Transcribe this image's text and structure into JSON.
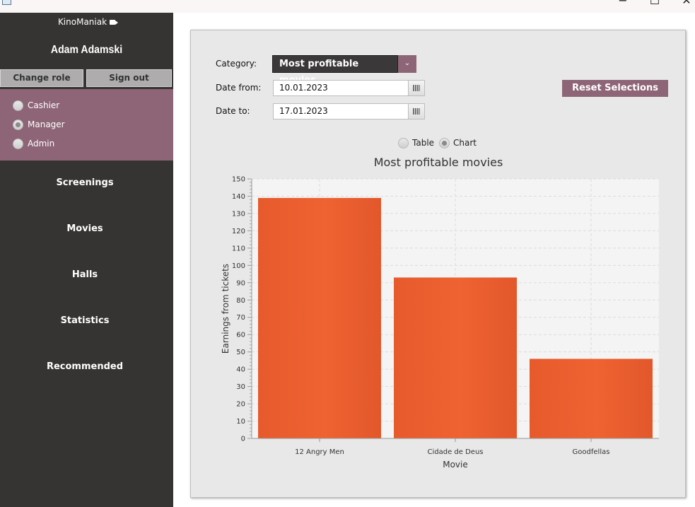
{
  "window": {
    "min_glyph": "−",
    "max_glyph": "☐",
    "close_glyph": "✕"
  },
  "sidebar": {
    "brand": "KinoManiak",
    "user_name": "Adam Adamski",
    "change_role_label": "Change role",
    "sign_out_label": "Sign out",
    "roles": [
      {
        "label": "Cashier",
        "selected": false
      },
      {
        "label": "Manager",
        "selected": true
      },
      {
        "label": "Admin",
        "selected": false
      }
    ],
    "nav": [
      "Screenings",
      "Movies",
      "Halls",
      "Statistics",
      "Recommended"
    ]
  },
  "filters": {
    "category_label": "Category:",
    "category_value": "Most profitable movies",
    "date_from_label": "Date from:",
    "date_from_value": "10.01.2023",
    "date_to_label": "Date to:",
    "date_to_value": "17.01.2023",
    "reset_label": "Reset Selections"
  },
  "view_toggle": {
    "table_label": "Table",
    "chart_label": "Chart",
    "selected": "Chart"
  },
  "chart_data": {
    "type": "bar",
    "title": "Most profitable movies",
    "xlabel": "Movie",
    "ylabel": "Earnings from tickets",
    "categories": [
      "12 Angry Men",
      "Cidade de Deus",
      "Goodfellas"
    ],
    "values": [
      139,
      93,
      46
    ],
    "ylim": [
      0,
      150
    ],
    "major_tick": 10,
    "grid": true,
    "legend": "none",
    "bar_color": "#ef6231",
    "plot_background": "#f4f4f4"
  }
}
